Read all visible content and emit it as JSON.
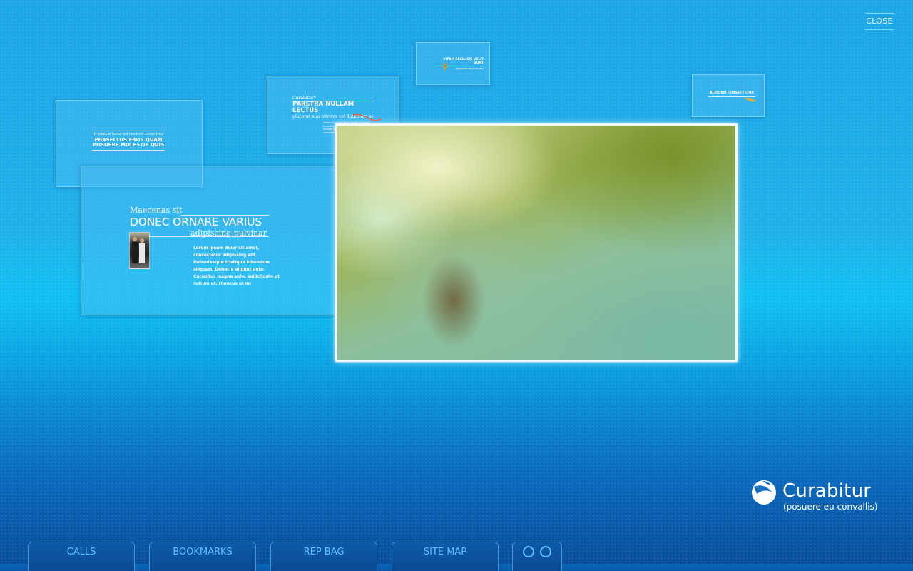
{
  "close_label": "CLOSE",
  "panels": {
    "left_small": {
      "line1": "Ut volutpat lectus sed hendrerit consectetur",
      "line2": "PHASELLUS EROS QUAM",
      "line3": "POSUERE MOLESTIE QUIS"
    },
    "center_small": {
      "line1": "Curabitur*",
      "line2": "PARETRA NULLAM LECTUS",
      "line3": "placerat non ultrices vel dignissim ac",
      "body": "vestibulum sed diam ornare convallis. Curabitur blandit tempus porttitor. Aenean lacinia bibendum nulla sed consectetur. Nulla vitae elit libero"
    },
    "top_small": {
      "line1": "VITAM FACILISIS VELIT SUNT",
      "line2": "dignissim rhoncus nisl"
    },
    "right_small": {
      "line1": "ALIQUAM CONSECTETUR"
    },
    "large": {
      "subtitle": "Maecenas sit",
      "title": "DONEC ORNARE VARIUS",
      "tagline": "adipiscing pulvinar",
      "body": [
        "Lorem ipsum dolor sit amet,",
        "consectetur adipiscing elit.",
        "Pellentesque tristique bibendum",
        "aliquam. Donec a aliquet ante.",
        "Curabitur magna ante, sollicitudin ut",
        "rutrum et, rhoncus ut mi"
      ]
    }
  },
  "logo": {
    "name": "Curabitur",
    "tagline": "(posuere eu convallis)"
  },
  "nav": {
    "calls": "CALLS",
    "bookmarks": "BOOKMARKS",
    "rep_bag": "REP BAG",
    "site_map": "SITE MAP"
  },
  "colors": {
    "nav_text": "#5ec4ff",
    "nav_bg": "#0a4a92",
    "video_border": "#f4f8f4"
  }
}
